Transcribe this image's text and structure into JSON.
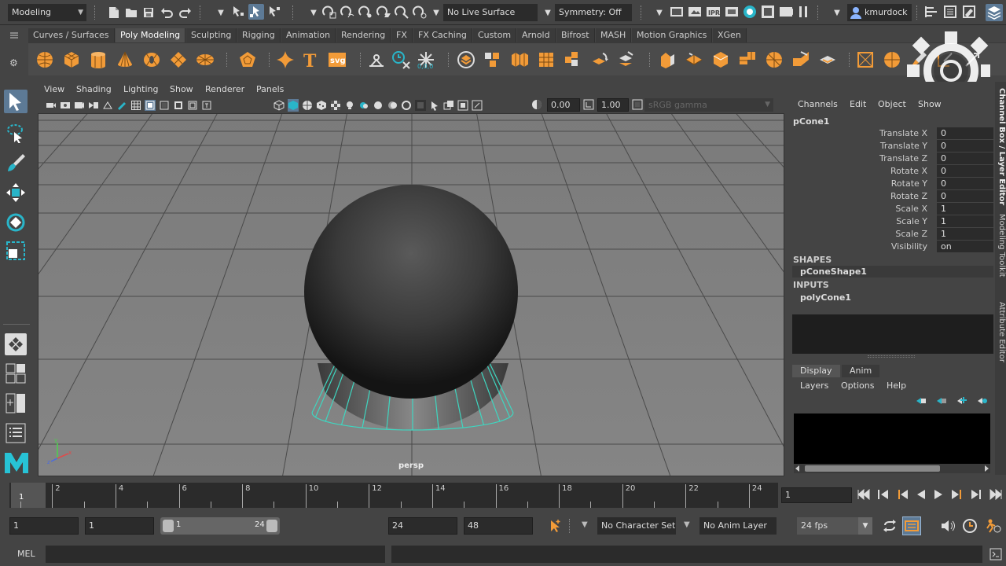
{
  "statusline": {
    "menuset": "Modeling",
    "live_surface": "No Live Surface",
    "symmetry": "Symmetry: Off",
    "user": "kmurdock"
  },
  "shelf_tabs": [
    "Curves / Surfaces",
    "Poly Modeling",
    "Sculpting",
    "Rigging",
    "Animation",
    "Rendering",
    "FX",
    "FX Caching",
    "Custom",
    "Arnold",
    "Bifrost",
    "MASH",
    "Motion Graphics",
    "XGen"
  ],
  "active_shelf_tab": "Poly Modeling",
  "viewport": {
    "menus": [
      "View",
      "Shading",
      "Lighting",
      "Show",
      "Renderer",
      "Panels"
    ],
    "exposure": "0.00",
    "gamma": "1.00",
    "colorspace": "sRGB gamma",
    "camera_label": "persp"
  },
  "channelbox": {
    "menus": [
      "Channels",
      "Edit",
      "Object",
      "Show"
    ],
    "object_name": "pCone1",
    "attributes": [
      {
        "label": "Translate X",
        "value": "0"
      },
      {
        "label": "Translate Y",
        "value": "0"
      },
      {
        "label": "Translate Z",
        "value": "0"
      },
      {
        "label": "Rotate X",
        "value": "0"
      },
      {
        "label": "Rotate Y",
        "value": "0"
      },
      {
        "label": "Rotate Z",
        "value": "0"
      },
      {
        "label": "Scale X",
        "value": "1"
      },
      {
        "label": "Scale Y",
        "value": "1"
      },
      {
        "label": "Scale Z",
        "value": "1"
      },
      {
        "label": "Visibility",
        "value": "on"
      }
    ],
    "shapes_header": "SHAPES",
    "shape_name": "pConeShape1",
    "inputs_header": "INPUTS",
    "input_name": "polyCone1"
  },
  "layer_editor": {
    "tabs": [
      "Display",
      "Anim"
    ],
    "menus": [
      "Layers",
      "Options",
      "Help"
    ]
  },
  "side_tabs": [
    "Channel Box / Layer Editor",
    "Modeling Toolkit",
    "Attribute Editor"
  ],
  "timeline": {
    "ticks": [
      "2",
      "4",
      "6",
      "8",
      "10",
      "12",
      "14",
      "16",
      "18",
      "20",
      "22",
      "24"
    ],
    "current_frame_marker": "1",
    "current_frame_field": "1"
  },
  "range": {
    "start_time": "1",
    "playback_start": "1",
    "slider_start": "1",
    "slider_end": "24",
    "playback_end": "24",
    "end_time": "48",
    "character_set": "No Character Set",
    "anim_layer": "No Anim Layer",
    "fps": "24 fps"
  },
  "cmdline": {
    "label": "MEL"
  },
  "colors": {
    "accent_orange": "#f29b38",
    "selection_blue": "#5d7a96",
    "wire_cyan": "#3fd6c0",
    "maya_logo": "#27c3d6"
  }
}
